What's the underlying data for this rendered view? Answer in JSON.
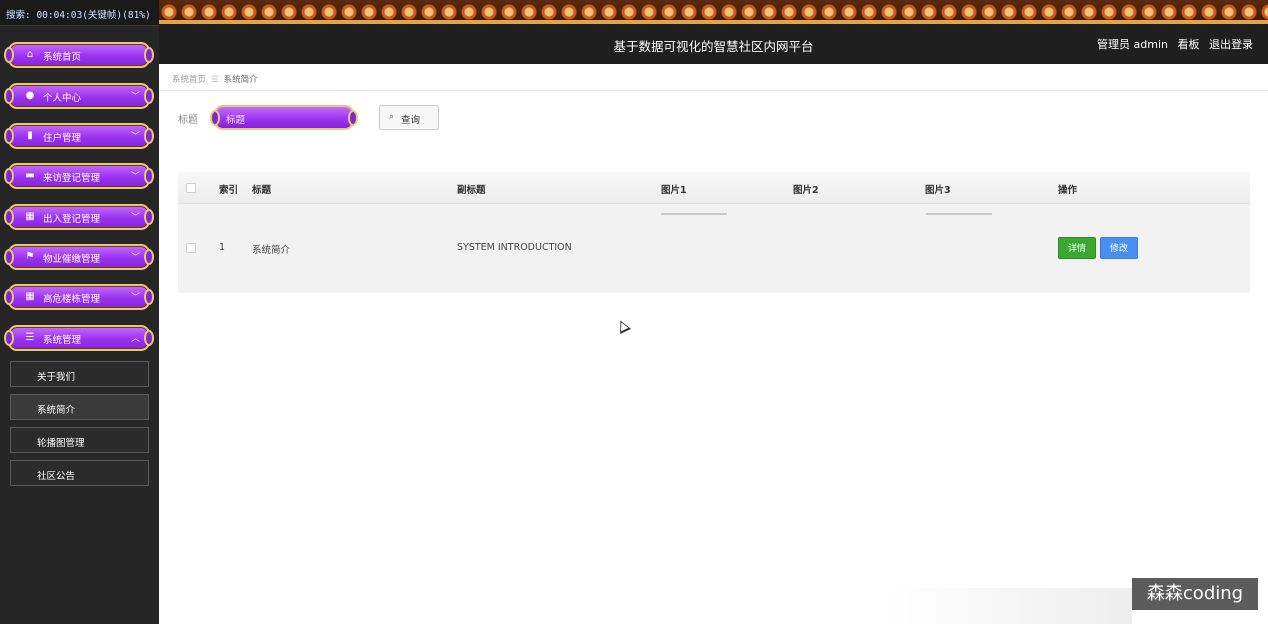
{
  "status_bar": {
    "text": "搜索: 00:04:03(关键帧)(81%)"
  },
  "header": {
    "title": "基于数据可视化的智慧社区内网平台",
    "user": "管理员 admin",
    "dashboard_link": "看板",
    "logout_link": "退出登录"
  },
  "sidebar": {
    "items": [
      {
        "label": "系统首页",
        "icon": "home-icon",
        "chevron": ""
      },
      {
        "label": "个人中心",
        "icon": "user-icon",
        "chevron": "﹀"
      },
      {
        "label": "住户管理",
        "icon": "chart-icon",
        "chevron": "﹀"
      },
      {
        "label": "来访登记管理",
        "icon": "monitor-icon",
        "chevron": "﹀"
      },
      {
        "label": "出入登记管理",
        "icon": "grid-icon",
        "chevron": "﹀"
      },
      {
        "label": "物业催缴管理",
        "icon": "flag-icon",
        "chevron": "﹀"
      },
      {
        "label": "高危楼栋管理",
        "icon": "grid-icon",
        "chevron": "﹀"
      },
      {
        "label": "系统管理",
        "icon": "sliders-icon",
        "chevron": "︿"
      }
    ],
    "subitems": [
      {
        "label": "关于我们"
      },
      {
        "label": "系统简介"
      },
      {
        "label": "轮播图管理"
      },
      {
        "label": "社区公告"
      }
    ]
  },
  "breadcrumb": {
    "home": "系统首页",
    "separator": "☰",
    "current": "系统简介"
  },
  "search": {
    "label": "标题",
    "placeholder": "标题",
    "button": "查询"
  },
  "table": {
    "columns": [
      "索引",
      "标题",
      "副标题",
      "图片1",
      "图片2",
      "图片3",
      "操作"
    ],
    "rows": [
      {
        "index": "1",
        "title": "系统简介",
        "subtitle": "SYSTEM INTRODUCTION",
        "detail_button": "详情",
        "edit_button": "修改"
      }
    ]
  },
  "watermark": "森森coding",
  "colors": {
    "menu_purple": "#9b33f0",
    "menu_border": "#e8c77a",
    "detail_green": "#3aa830",
    "edit_blue": "#4a8ff0"
  }
}
